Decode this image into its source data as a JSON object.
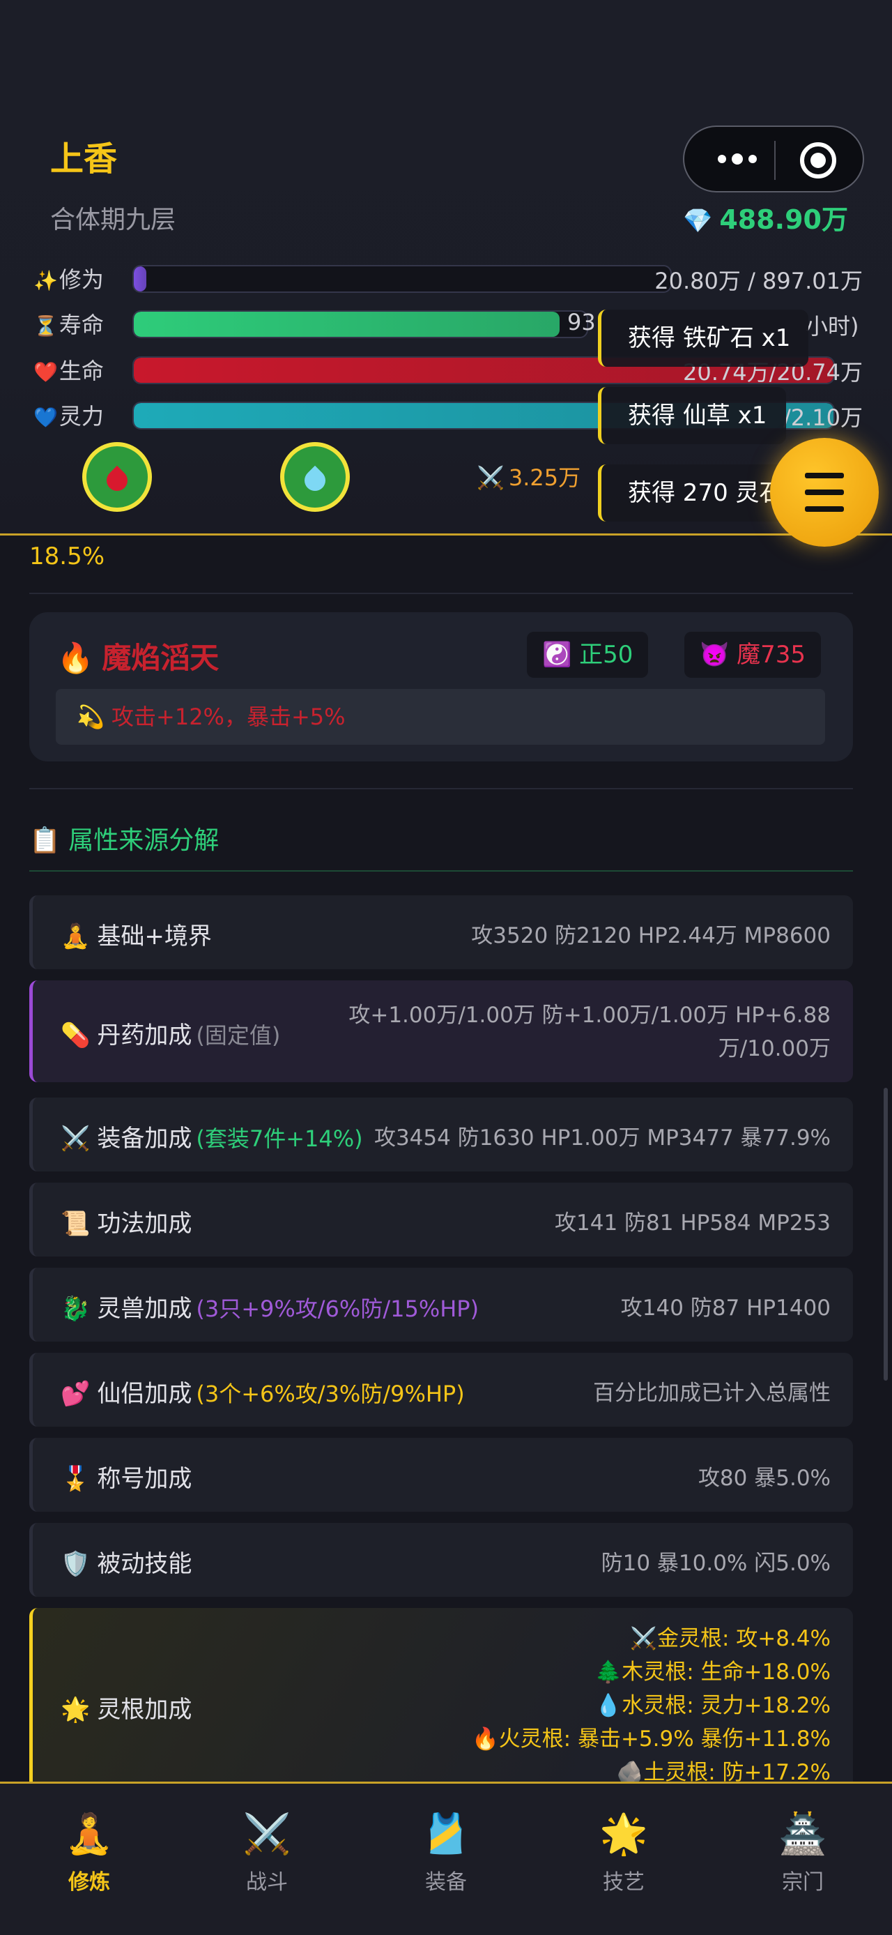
{
  "character": {
    "name": "上香",
    "realm": "合体期九层",
    "spirit_stones": "488.90万",
    "power": "3.25万",
    "progress_pct": "18.5%"
  },
  "stats": [
    {
      "label": "修为",
      "icon": "✨",
      "value": "20.80万 / 897.01万",
      "fill": 0.02,
      "color": "#7b4fe0"
    },
    {
      "label": "寿命",
      "icon": "⏳",
      "value": "93",
      "value_tail": "小时)",
      "fill": 0.94,
      "color": "#2ecc7a"
    },
    {
      "label": "生命",
      "icon": "❤️",
      "value": "20.74万/20.74万",
      "fill": 1.0,
      "color": "#c8182c"
    },
    {
      "label": "灵力",
      "icon": "💙",
      "value": "/2.10万",
      "fill": 1.0,
      "color": "#1eaab8"
    }
  ],
  "toasts": [
    "获得 铁矿石 x1",
    "获得 仙草 x1",
    "获得 270 灵石"
  ],
  "path": {
    "name": "魔焰滔天",
    "righteous": "正50",
    "demonic": "魔735",
    "bonus": "攻击+12%，暴击+5%"
  },
  "breakdown": {
    "title": "属性来源分解",
    "items": [
      {
        "icon": "🧘",
        "name": "基础+境界",
        "note": "",
        "value": "攻3520 防2120 HP2.44万 MP8600"
      },
      {
        "icon": "💊",
        "name": "丹药加成",
        "note": "(固定值)",
        "value": "攻+1.00万/1.00万 防+1.00万/1.00万 HP+6.88万/10.00万"
      },
      {
        "icon": "⚔️",
        "name": "装备加成",
        "note": "(套装7件+14%)",
        "value": "攻3454 防1630 HP1.00万 MP3477 暴77.9%"
      },
      {
        "icon": "📜",
        "name": "功法加成",
        "note": "",
        "value": "攻141 防81 HP584 MP253"
      },
      {
        "icon": "🐉",
        "name": "灵兽加成",
        "note": "(3只+9%攻/6%防/15%HP)",
        "value": "攻140 防87 HP1400"
      },
      {
        "icon": "💕",
        "name": "仙侣加成",
        "note": "(3个+6%攻/3%防/9%HP)",
        "value": "百分比加成已计入总属性"
      },
      {
        "icon": "🎖️",
        "name": "称号加成",
        "note": "",
        "value": "攻80 暴5.0%"
      },
      {
        "icon": "🛡️",
        "name": "被动技能",
        "note": "",
        "value": "防10 暴10.0% 闪5.0%"
      },
      {
        "icon": "🌟",
        "name": "灵根加成",
        "note": "",
        "value": ""
      }
    ],
    "roots": [
      "⚔️金灵根: 攻+8.4%",
      "🌲木灵根: 生命+18.0%",
      "💧水灵根: 灵力+18.2%",
      "🔥火灵根: 暴击+5.9% 暴伤+11.8%",
      "🪨土灵根: 防+17.2%"
    ]
  },
  "tabs": [
    {
      "label": "修炼",
      "icon": "🧘",
      "active": true
    },
    {
      "label": "战斗",
      "icon": "⚔️",
      "active": false
    },
    {
      "label": "装备",
      "icon": "🎽",
      "active": false
    },
    {
      "label": "技艺",
      "icon": "🌟",
      "active": false
    },
    {
      "label": "宗门",
      "icon": "🏯",
      "active": false
    }
  ]
}
